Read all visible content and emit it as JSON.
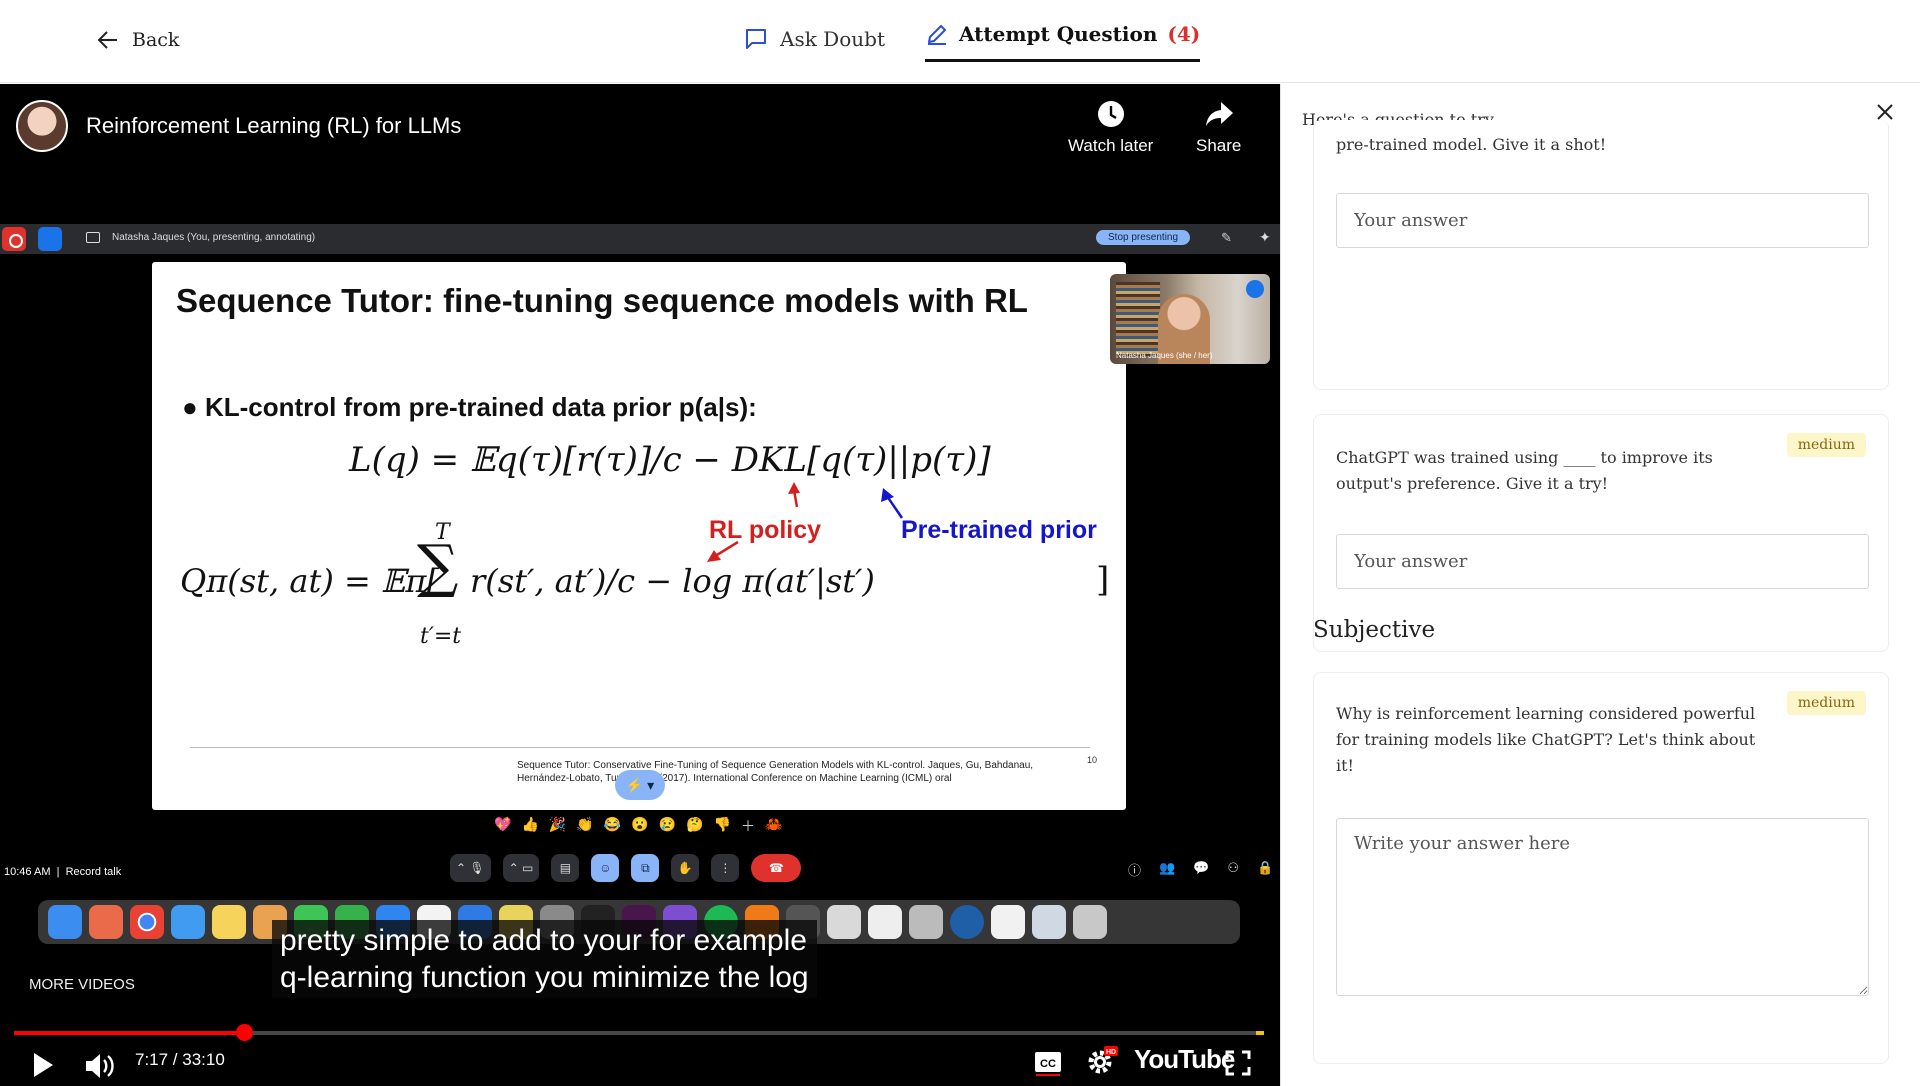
{
  "topbar": {
    "back_label": "Back",
    "ask_doubt_label": "Ask Doubt",
    "attempt_label": "Attempt Question",
    "attempt_count": "(4)"
  },
  "video": {
    "title": "Reinforcement Learning (RL) for LLMs",
    "watch_later_label": "Watch later",
    "share_label": "Share",
    "share_bar_text": "Natasha Jaques (You, presenting, annotating)",
    "stop_presenting_label": "Stop presenting",
    "slide": {
      "title": "Sequence Tutor: fine-tuning sequence models with RL",
      "bullet": "KL-control from pre-trained data prior p(a|s):",
      "eq1": "L(q) = 𝔼q(τ)[r(τ)]/c − DKL[q(τ)||p(τ)]",
      "eq2_left": "Qπ(st, at) = 𝔼π[",
      "sum_top": "T",
      "sum_bottom": "t′=t",
      "eq2_right": "r(st′, at′)/c  − log π(at′|st′)",
      "eq2_close": "]",
      "label_rl": "RL policy",
      "label_prior": "Pre-trained prior",
      "citation": "Sequence Tutor: Conservative Fine-Tuning of Sequence Generation Models with KL-control. Jaques, Gu, Bahdanau, Hernández-Lobato, Turner, Eck (2017). International Conference on Machine Learning (ICML) oral",
      "page_number": "10"
    },
    "camera_tag": "Natasha Jaques (she / her)",
    "meet_clock": "10:46 AM",
    "meet_record": "Record talk",
    "caption_line1": "pretty simple to add to your for example",
    "caption_line2": "q-learning function you minimize the log",
    "more_videos_label": "MORE VIDEOS",
    "time_display": "7:17 / 33:10",
    "progress_fraction": 0.184,
    "youtube_logo": "YouTube"
  },
  "panel": {
    "heading": "Here's a question to try",
    "cards": [
      {
        "question": "pre-trained model. Give it a shot!",
        "answer_placeholder": "Your answer"
      },
      {
        "question": "ChatGPT was trained using ____ to improve its output's preference. Give it a try!",
        "difficulty": "medium",
        "answer_placeholder": "Your answer"
      }
    ],
    "subjective_title": "Subjective",
    "subjective_card": {
      "question": "Why is reinforcement learning considered powerful for training models like ChatGPT? Let's think about it!",
      "difficulty": "medium",
      "answer_placeholder": "Write your answer here"
    }
  },
  "colors": {
    "accent_red": "#d9302c",
    "badge_bg": "#fdf6c9",
    "youtube_red": "#ff0000",
    "slide_rl_label": "#d41f1f",
    "slide_prior_label": "#1515c9"
  }
}
